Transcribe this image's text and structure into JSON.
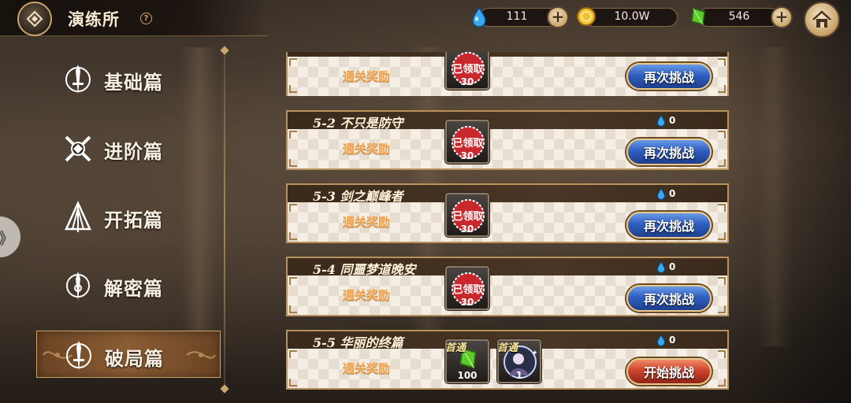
{
  "header": {
    "title": "演练所",
    "help_label": "?",
    "resources": [
      {
        "name": "blue-drop",
        "icon": "blue-drop-icon",
        "value": "111"
      },
      {
        "name": "gold-coin",
        "icon": "gold-coin-icon",
        "value": "10.0W"
      },
      {
        "name": "green-crystal",
        "icon": "green-crystal-icon",
        "value": "546"
      }
    ],
    "plus_label": "+",
    "home_icon": "home-icon",
    "back_icon": "back-icon"
  },
  "sidebar": {
    "handle_label": "》",
    "items": [
      {
        "label": "基础篇",
        "icon": "sword-emblem-icon",
        "active": false
      },
      {
        "label": "进阶篇",
        "icon": "crossed-swords-emblem-icon",
        "active": false
      },
      {
        "label": "开拓篇",
        "icon": "tent-emblem-icon",
        "active": false
      },
      {
        "label": "解密篇",
        "icon": "lock-emblem-icon",
        "active": false
      },
      {
        "label": "破局篇",
        "icon": "sword-emblem-icon",
        "active": true
      }
    ]
  },
  "stages": [
    {
      "title": "",
      "reward_label": "通关奖励",
      "gem_count": "",
      "claimed_text": "已领取",
      "item_count": "30",
      "button": "再次挑战"
    },
    {
      "title": "5-2 不只是防守",
      "reward_label": "通关奖励",
      "gem_count": "0",
      "claimed_text": "已领取",
      "item_count": "30",
      "button": "再次挑战"
    },
    {
      "title": "5-3 剑之巅峰者",
      "reward_label": "通关奖励",
      "gem_count": "0",
      "claimed_text": "已领取",
      "item_count": "30",
      "button": "再次挑战"
    },
    {
      "title": "5-4 同噩梦道晚安",
      "reward_label": "通关奖励",
      "gem_count": "0",
      "claimed_text": "已领取",
      "item_count": "30",
      "button": "再次挑战"
    },
    {
      "title": "5-5 华丽的终篇",
      "reward_label": "通关奖励",
      "gem_count": "0",
      "first_clear_items": [
        {
          "tag": "首通",
          "icon": "green-crystal-icon",
          "count": "100"
        },
        {
          "tag": "首通",
          "icon": "character-portrait-icon",
          "count": "1"
        }
      ],
      "button": "开始挑战"
    }
  ],
  "colors": {
    "accent_gold": "#c9a66b",
    "reward_orange": "#f2a24a",
    "btn_blue": "#2f5fc0",
    "btn_red": "#d0442c",
    "stamp_red": "#c8282c"
  }
}
